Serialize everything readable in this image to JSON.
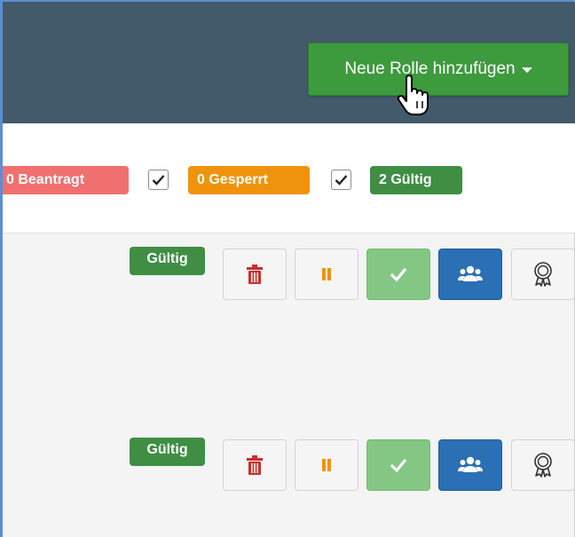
{
  "header": {
    "add_role_button": {
      "label": "Neue Rolle hinzufügen"
    }
  },
  "filters": [
    {
      "label": "0 Beantragt",
      "color": "#f07070",
      "checked": false
    },
    {
      "label": "0 Gesperrt",
      "color": "#f0930c",
      "checked": true
    },
    {
      "label": "2 Gültig",
      "color": "#3f8e43",
      "checked": true
    }
  ],
  "rows": [
    {
      "status": "Gültig",
      "actions": [
        "delete",
        "suspend",
        "approve",
        "members",
        "certificate"
      ]
    },
    {
      "status": "Gültig",
      "actions": [
        "delete",
        "suspend",
        "approve",
        "members",
        "certificate"
      ]
    }
  ],
  "colors": {
    "header_bg": "#435a6b",
    "primary_green": "#3d9a3d",
    "danger": "#c9302c",
    "warning": "#f0930c",
    "info_blue": "#2b6fb4"
  },
  "icons": {
    "delete": "trash-icon",
    "suspend": "pause-icon",
    "approve": "check-icon",
    "members": "users-icon",
    "certificate": "award-icon",
    "cursor": "hand-pointer-icon"
  }
}
